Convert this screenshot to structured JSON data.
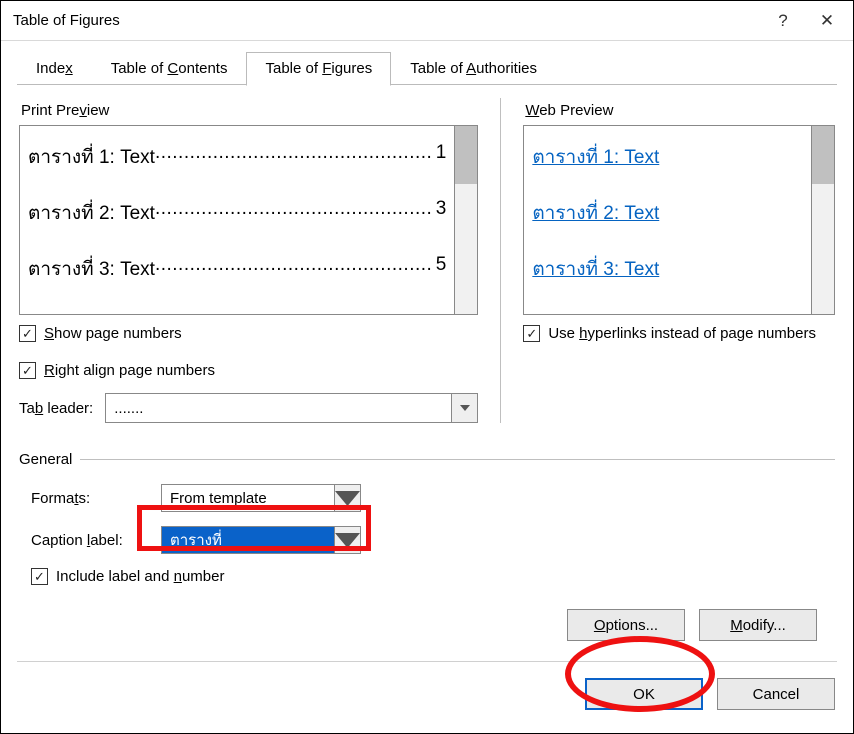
{
  "titlebar": {
    "title": "Table of Figures",
    "help": "?",
    "close": "✕"
  },
  "tabs": {
    "index_pre": "Inde",
    "index_u": "x",
    "toc_pre": "Table of ",
    "toc_u": "C",
    "toc_post": "ontents",
    "tof_pre": "Table of ",
    "tof_u": "F",
    "tof_post": "igures",
    "toa_pre": "Table of ",
    "toa_u": "A",
    "toa_post": "uthorities"
  },
  "labels": {
    "print_pre": "Print Pre",
    "print_u": "v",
    "print_post": "iew",
    "web_u": "W",
    "web_post": "eb Preview",
    "show_u": "S",
    "show_post": "how page numbers",
    "right_u": "R",
    "right_post": "ight align page numbers",
    "tableader_pre": "Ta",
    "tableader_u": "b",
    "tableader_post": " leader:",
    "use_pre": "Use ",
    "use_u": "h",
    "use_post": "yperlinks instead of page numbers",
    "general": "General",
    "formats_pre": "Forma",
    "formats_u": "t",
    "formats_post": "s:",
    "caption_pre": "Caption ",
    "caption_u": "l",
    "caption_post": "abel:",
    "include_pre": "Include label and ",
    "include_u": "n",
    "include_post": "umber",
    "options_u": "O",
    "options_post": "ptions...",
    "modify_u": "M",
    "modify_post": "odify...",
    "ok": "OK",
    "cancel": "Cancel"
  },
  "preview": {
    "p1_label": "ตารางที่ 1: Text ",
    "p1_page": "1",
    "p2_label": "ตารางที่ 2: Text ",
    "p2_page": "3",
    "p3_label": "ตารางที่ 3: Text ",
    "p3_page": "5",
    "dots": "................................................"
  },
  "web": {
    "l1": "ตารางที่ 1: Text",
    "l2": "ตารางที่ 2: Text",
    "l3": "ตารางที่ 3: Text"
  },
  "selects": {
    "tab_leader": ".......",
    "formats": "From template",
    "caption_label": "ตารางที่"
  },
  "checks": {
    "show": "✓",
    "right": "✓",
    "hyper": "✓",
    "include": "✓"
  }
}
